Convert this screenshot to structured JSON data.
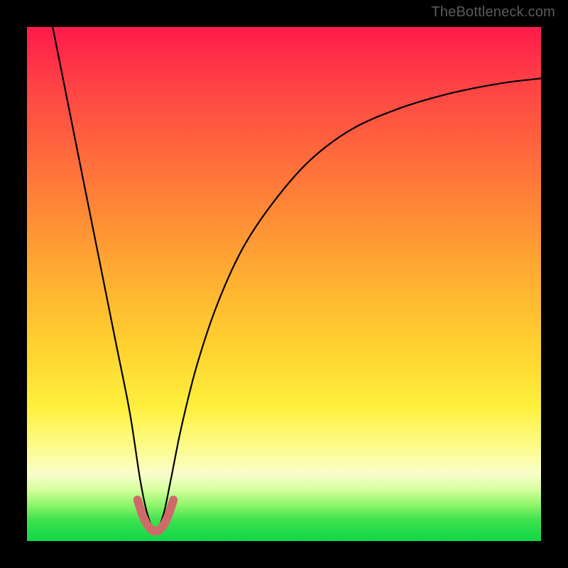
{
  "watermark": "TheBottleneck.com",
  "chart_data": {
    "type": "line",
    "title": "",
    "xlabel": "",
    "ylabel": "",
    "xlim": [
      0,
      100
    ],
    "ylim": [
      0,
      100
    ],
    "series": [
      {
        "name": "bottleneck-curve",
        "color": "#000000",
        "x": [
          5,
          8,
          11,
          14,
          17,
          20,
          22,
          23.5,
          25,
          26.5,
          28,
          30,
          33,
          37,
          42,
          48,
          55,
          63,
          72,
          82,
          92,
          100
        ],
        "y": [
          100,
          85,
          70,
          55,
          40,
          25,
          12,
          5,
          2,
          5,
          12,
          22,
          34,
          46,
          57,
          66,
          74,
          80,
          84,
          87,
          89,
          90
        ]
      },
      {
        "name": "highlight-trough",
        "color": "#cf6a6a",
        "x": [
          21.5,
          22.5,
          23.5,
          24.5,
          25,
          25.5,
          26.5,
          27.5,
          28.5
        ],
        "y": [
          8,
          5,
          3,
          2,
          2,
          2,
          3,
          5,
          8
        ]
      }
    ],
    "gradient_background": true
  }
}
